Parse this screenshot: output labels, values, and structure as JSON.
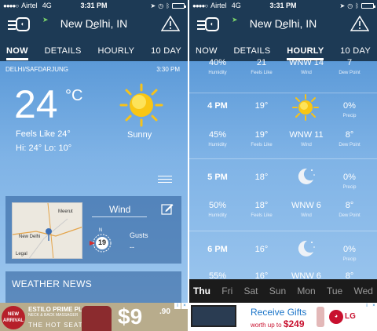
{
  "left": {
    "status": {
      "signal": "●●●●○",
      "carrier": "Airtel",
      "network": "4G",
      "time": "3:31 PM"
    },
    "header": {
      "city": "New Delhi, IN"
    },
    "tabs": [
      {
        "label": "NOW",
        "active": true
      },
      {
        "label": "DETAILS"
      },
      {
        "label": "HOURLY"
      },
      {
        "label": "10 DAY"
      }
    ],
    "now": {
      "station": "DELHI/SAFDARJUNG",
      "obs_time": "3:30 PM",
      "temp": "24",
      "unit": "°C",
      "feels_like": "Feels Like 24°",
      "hi_lo": "Hi: 24°  Lo: 10°",
      "condition": "Sunny",
      "icon": "sun-icon"
    },
    "wind_card": {
      "title": "Wind",
      "speed": "19",
      "compass_n": "N",
      "gusts_label": "Gusts",
      "gusts_value": "--",
      "map_labels": {
        "city": "New Delhi",
        "meerut": "Meerut",
        "legal": "Legal"
      }
    },
    "news": {
      "title": "WEATHER NEWS"
    },
    "ad": {
      "badge": "NEW ARRIVAL",
      "brand": "ESTILO PRIME PLUS",
      "sub": "NECK & BACK MASSAGER",
      "tagline": "THE HOT SEAT",
      "price": "$9",
      "cents": ".90"
    }
  },
  "right": {
    "status": {
      "signal": "●●●●○",
      "carrier": "Airtel",
      "network": "4G",
      "time": "3:31 PM"
    },
    "header": {
      "city": "New Delhi, IN"
    },
    "tabs": [
      {
        "label": "NOW"
      },
      {
        "label": "DETAILS"
      },
      {
        "label": "HOURLY",
        "active": true
      },
      {
        "label": "10 DAY"
      }
    ],
    "top_row": {
      "humidity": "40%",
      "humidity_label": "Humidity",
      "feels": "21",
      "feels_label": "Feels Like",
      "wind": "WNW 14",
      "wind_label": "Wind",
      "dew": "7",
      "dew_label": "Dew Point"
    },
    "hours": [
      {
        "time": "4 PM",
        "temp": "19°",
        "icon": "sun-icon",
        "precip": "0%",
        "precip_label": "Precip",
        "humidity": "45%",
        "humidity_label": "Humidity",
        "feels": "19°",
        "feels_label": "Feels Like",
        "wind": "WNW 11",
        "wind_label": "Wind",
        "dew": "8°",
        "dew_label": "Dew Point"
      },
      {
        "time": "5 PM",
        "temp": "18°",
        "icon": "moon-icon",
        "precip": "0%",
        "precip_label": "Precip",
        "humidity": "50%",
        "humidity_label": "Humidity",
        "feels": "18°",
        "feels_label": "Feels Like",
        "wind": "WNW 6",
        "wind_label": "Wind",
        "dew": "8°",
        "dew_label": "Dew Point"
      },
      {
        "time": "6 PM",
        "temp": "16°",
        "icon": "moon-icon",
        "precip": "0%",
        "precip_label": "Precip",
        "humidity": "55%",
        "feels": "16°",
        "wind": "WNW 6",
        "dew": "8°"
      }
    ],
    "days": [
      "Thu",
      "Fri",
      "Sat",
      "Sun",
      "Mon",
      "Tue",
      "Wed"
    ],
    "ad": {
      "headline": "Receive Gifts",
      "worth": "worth up to",
      "amount": "$249",
      "brand": "LG"
    }
  }
}
